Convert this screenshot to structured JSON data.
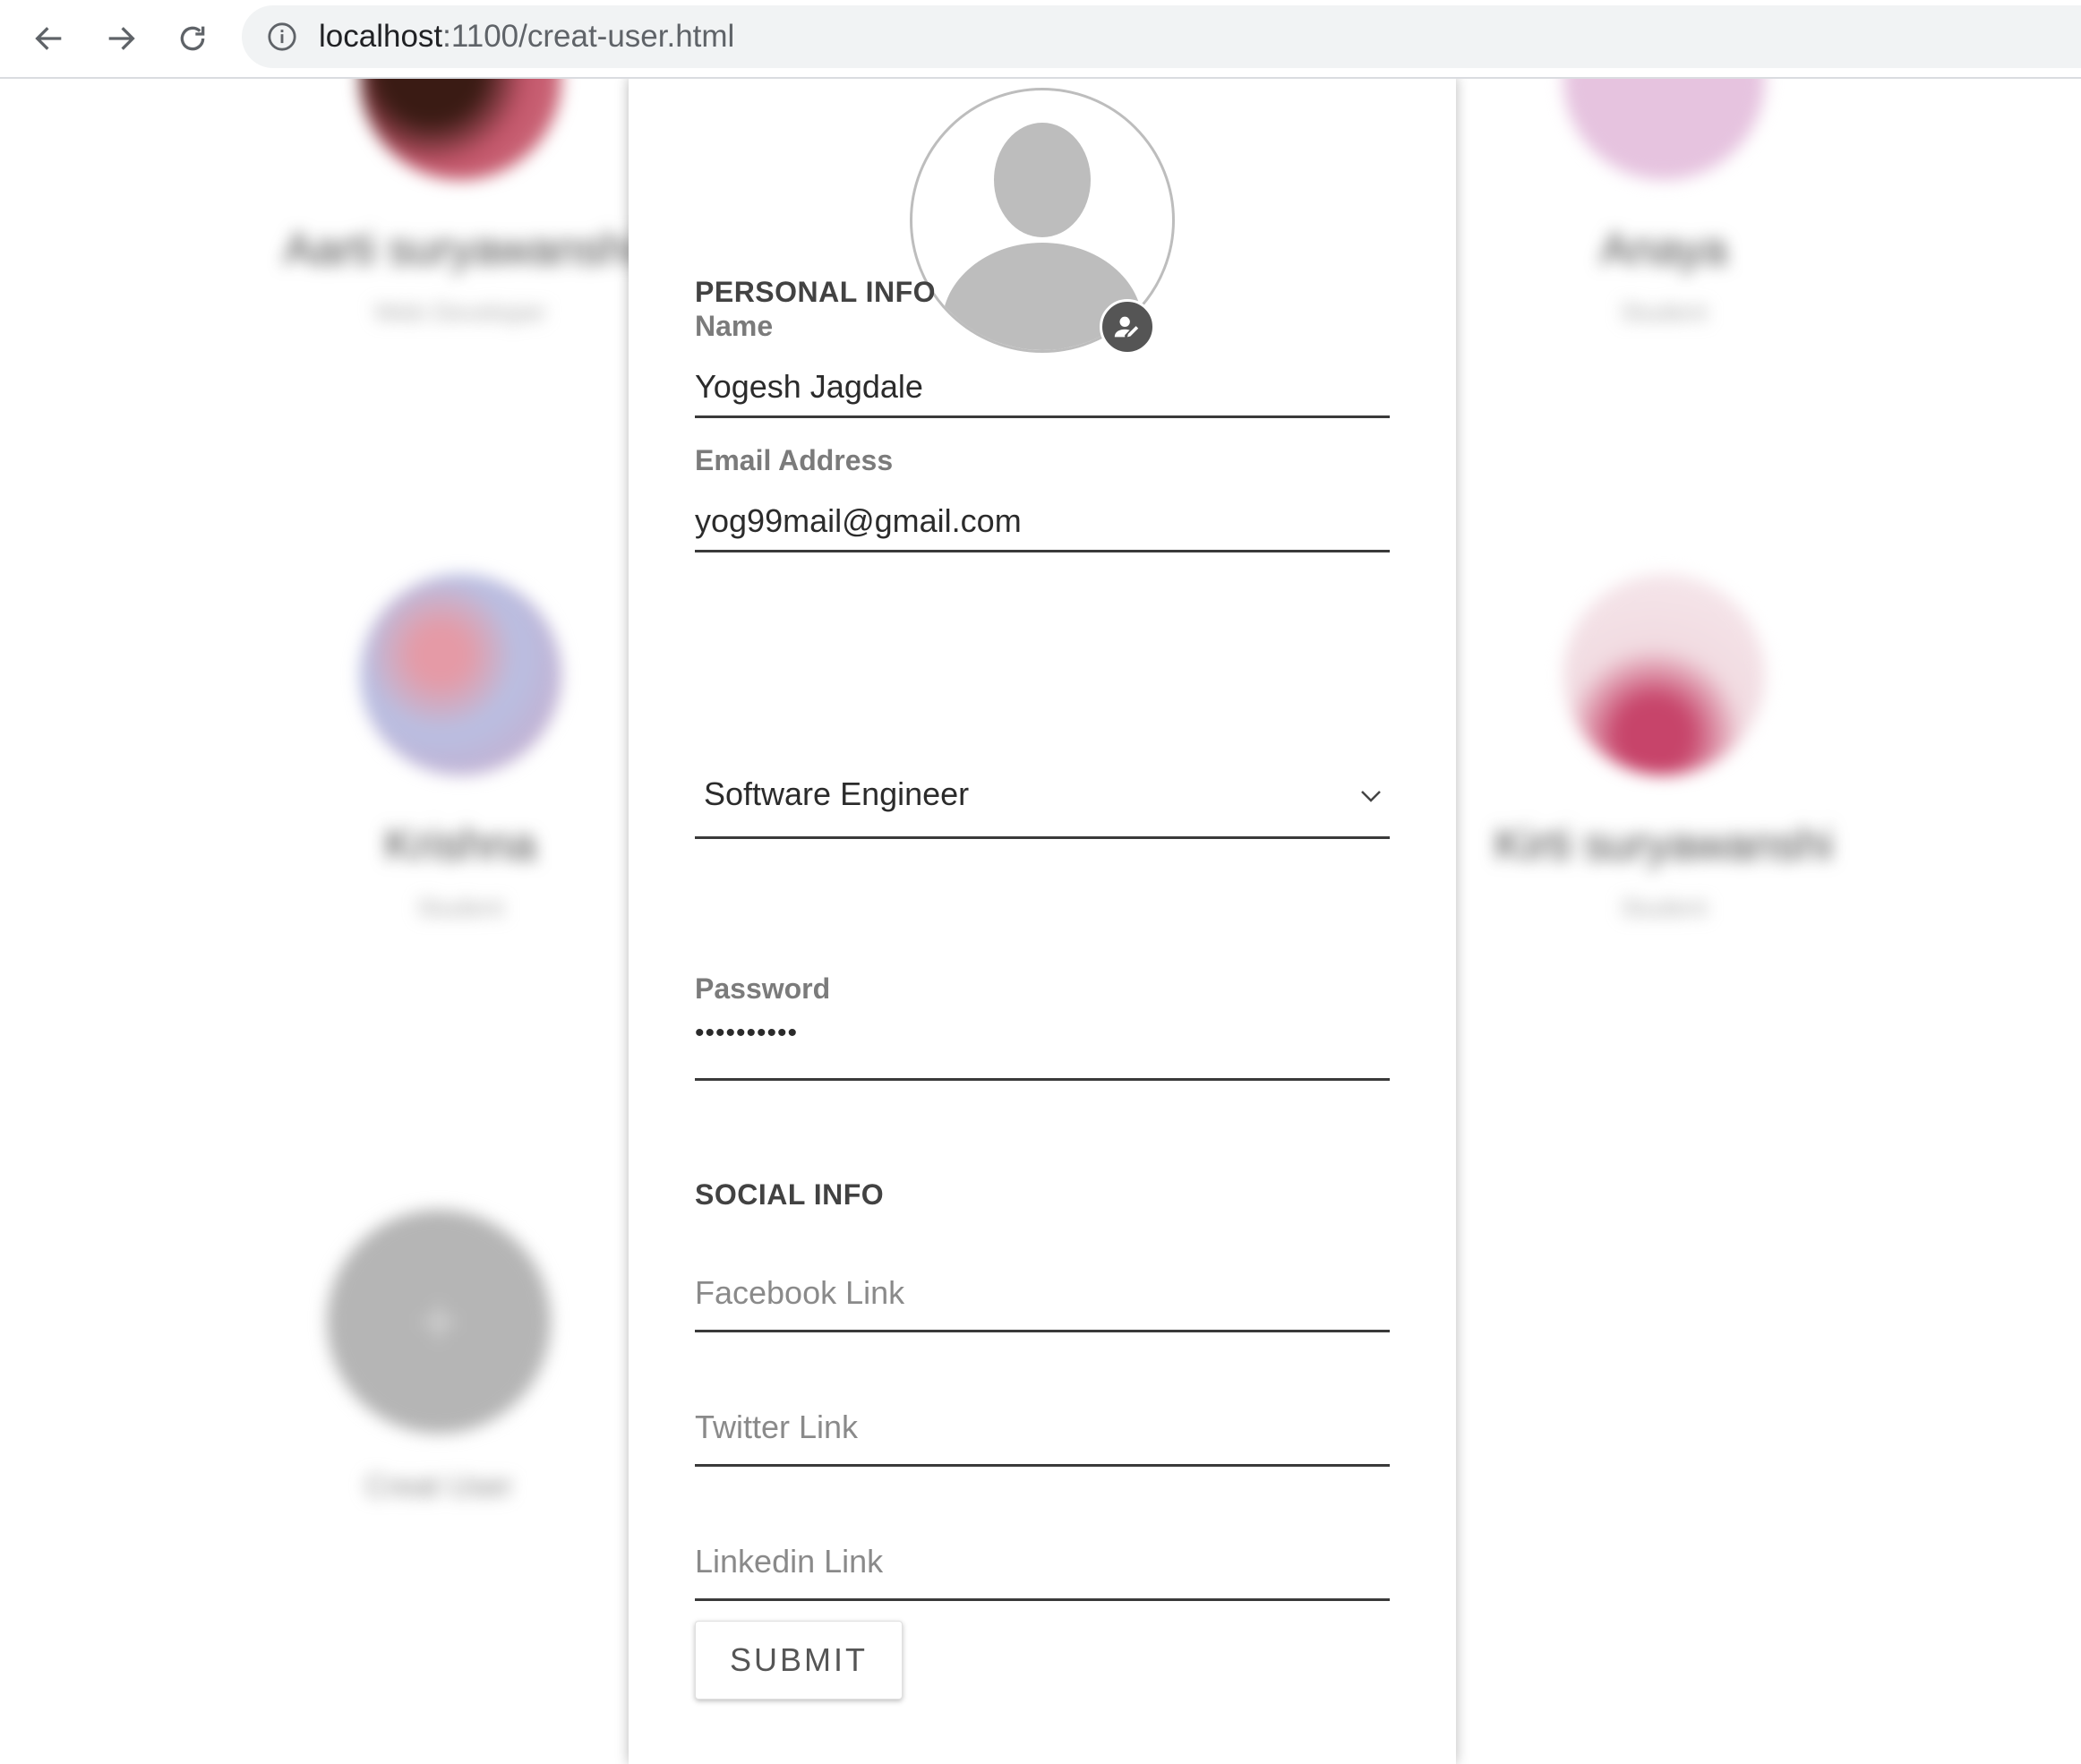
{
  "browser": {
    "url_host": "localhost",
    "url_path": ":1100/creat-user.html"
  },
  "background_users": [
    {
      "name": "Aarti suryawanshi",
      "role": "Web Developer",
      "avatar_color": "#c2566a"
    },
    {
      "name": "Anaya",
      "role": "Student",
      "avatar_color": "#e6c3df"
    },
    {
      "name": "Krishna",
      "role": "Student",
      "avatar_color": "#b9bfe2"
    },
    {
      "name": "Kirti suryawanshi",
      "role": "Student",
      "avatar_color": "#f1dbe1"
    }
  ],
  "create_card": {
    "plus": "+",
    "label": "Creat User"
  },
  "form": {
    "personal_title": "PERSONAL INFO",
    "name_label": "Name",
    "name_value": "Yogesh Jagdale",
    "email_label": "Email Address",
    "email_value": "yog99mail@gmail.com",
    "role_value": "Software Engineer",
    "password_label": "Password",
    "password_value": "••••••••••",
    "social_title": "SOCIAL INFO",
    "facebook_placeholder": "Facebook Link",
    "twitter_placeholder": "Twitter Link",
    "linkedin_placeholder": "Linkedin Link",
    "submit_label": "SUBMIT"
  },
  "icons": {
    "back": "arrow-left-icon",
    "forward": "arrow-right-icon",
    "reload": "reload-icon",
    "info": "info-icon",
    "avatar": "user-silhouette-icon",
    "edit_avatar": "user-edit-icon",
    "dropdown": "chevron-down-icon"
  },
  "colors": {
    "panel_bg": "#ffffff",
    "underline": "#3a3a3a",
    "label": "#7b7b7b",
    "avatar_gray": "#bdbdbd"
  }
}
